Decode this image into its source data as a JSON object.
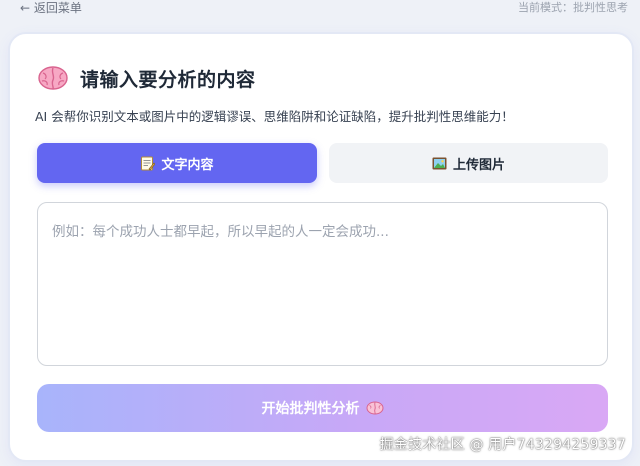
{
  "topbar": {
    "back_label": "← 返回菜单",
    "mode_text": "当前模式：批判性思考"
  },
  "header": {
    "title_icon": "brain-icon",
    "title": "请输入要分析的内容",
    "subtitle": "AI 会帮你识别文本或图片中的逻辑谬误、思维陷阱和论证缺陷，提升批判性思维能力！"
  },
  "tabs": [
    {
      "icon": "memo-icon",
      "label": "文字内容",
      "active": true
    },
    {
      "icon": "picture-icon",
      "label": "上传图片",
      "active": false
    }
  ],
  "input": {
    "placeholder": "例如：每个成功人士都早起，所以早起的人一定会成功..."
  },
  "action": {
    "label": "开始批判性分析",
    "icon": "brain-icon"
  },
  "watermark": "掘金技术社区 @ 用户743294259337",
  "colors": {
    "accent": "#6366f1",
    "button_gradient_start": "#a8b4fb",
    "button_gradient_end": "#d9a8f5",
    "background": "#eef1f7"
  }
}
